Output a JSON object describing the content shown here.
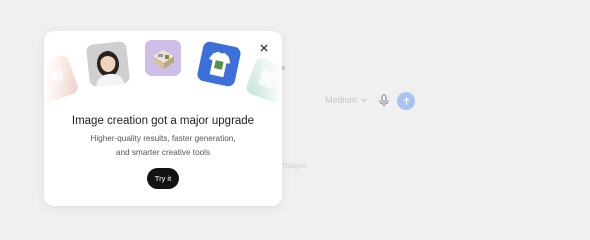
{
  "popup": {
    "title": "Image creation got a major upgrade",
    "description_line1": "Higher-quality results, faster generation,",
    "description_line2": "and smarter creative tools",
    "cta_label": "Try it",
    "thumbnails": [
      "sample-image-left",
      "portrait-photo",
      "room-render",
      "tshirt-mockup",
      "sample-image-right"
    ]
  },
  "background": {
    "quality_select_value": "Medium",
    "send_color": "#a9c4f1",
    "hint_text": "mages"
  },
  "colors": {
    "cta_bg": "#131316",
    "page_bg": "#f0f0f1"
  }
}
